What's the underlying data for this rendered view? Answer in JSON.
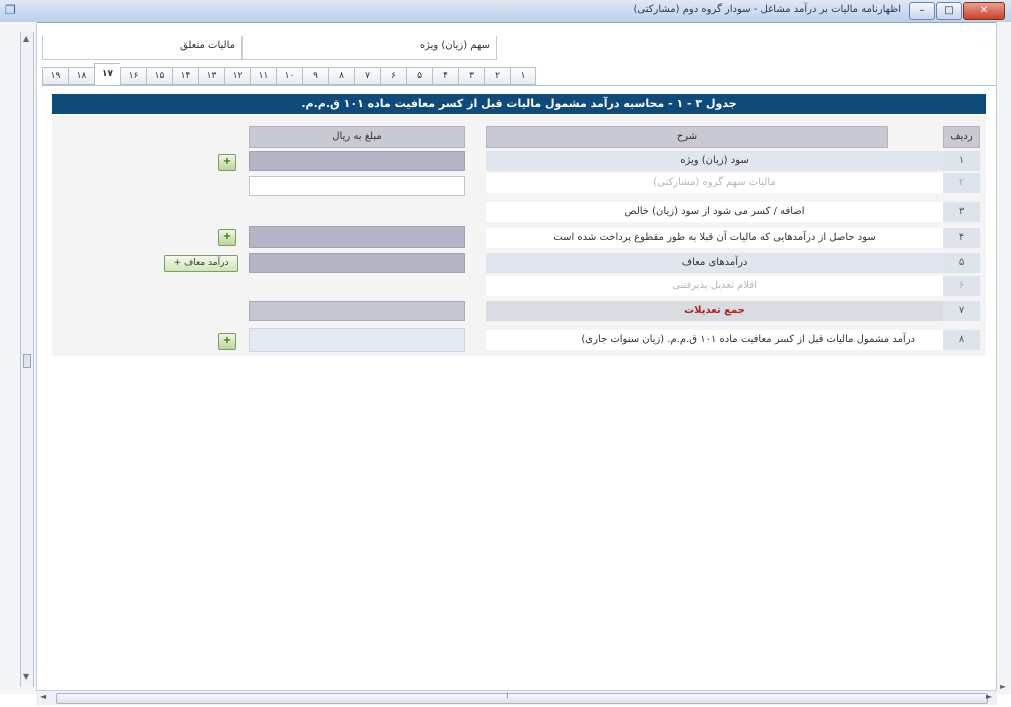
{
  "window": {
    "title": "اظهارنامه مالیات بر درآمد مشاغل - سودار گروه دوم (مشارکتی)",
    "minimize": "–",
    "maximize": "□",
    "close": "✕",
    "app_icon": "app-icon"
  },
  "header_fields": {
    "field1": "سهم (زیان) ویژه",
    "field2": "مالیات متعلق"
  },
  "tabs": [
    "۱۹",
    "۱۸",
    "۱۷",
    "۱۶",
    "۱۵",
    "۱۴",
    "۱۳",
    "۱۲",
    "۱۱",
    "۱۰",
    "۹",
    "۸",
    "۷",
    "۶",
    "۵",
    "۴",
    "۳",
    "۲",
    "۱"
  ],
  "active_tab": "۱۷",
  "banner": "جدول ۳ - ۱ - محاسبه درآمد مشمول مالیات قبل از کسر معافیت ماده ۱۰۱ ق.م.م.",
  "table": {
    "col_row": "ردیف",
    "col_desc": "شرح",
    "col_amount": "مبلغ به ریال",
    "rows": [
      {
        "num": "۱",
        "desc": "سود (زیان) ویژه",
        "amount": "",
        "dim": false
      },
      {
        "num": "۲",
        "desc": "مالیات سهم گروه (مشارکتی)",
        "amount": "",
        "dim": true
      },
      {
        "num": "۳",
        "desc": "اضافه / کسر می شود از سود (زیان) خالص",
        "amount": "",
        "dim": false
      },
      {
        "num": "۴",
        "desc": "سود حاصل از درآمدهایی که مالیات آن قبلا به طور مقطوع پرداخت شده است",
        "amount": "",
        "dim": false
      },
      {
        "num": "۵",
        "desc": "درآمدهای معاف",
        "amount": "",
        "dim": false
      },
      {
        "num": "۶",
        "desc": "اقلام تعدیل پذیرفتنی",
        "amount": "",
        "dim": true
      },
      {
        "num": "۷",
        "desc": "جمع تعدیلات",
        "amount": "",
        "dim": false,
        "total": true
      },
      {
        "num": "۸",
        "desc": "درآمد مشمول مالیات قبل از کسر معافیت ماده ۱۰۱ ق.م.م. (زیان سنوات جاری)",
        "amount": "",
        "dim": false
      }
    ]
  },
  "buttons": {
    "add": "+",
    "exempt_income": "درآمد معاف"
  },
  "scroll": {
    "left_arrow": "◄",
    "right_arrow": "►",
    "up_arrow": "▲",
    "down_arrow": "▼",
    "grip": "⁞"
  }
}
